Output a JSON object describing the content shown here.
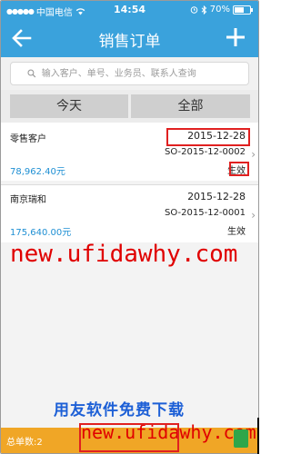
{
  "status_bar": {
    "carrier": "中国电信",
    "time": "14:54",
    "battery_text": "70%",
    "battery_level": 0.7
  },
  "nav": {
    "title": "销售订单",
    "back_icon": "arrow-left-icon",
    "add_icon": "plus-icon"
  },
  "search": {
    "placeholder": "输入客户、单号、业务员、联系人查询",
    "value": ""
  },
  "tabs": [
    {
      "label": "今天"
    },
    {
      "label": "全部"
    }
  ],
  "orders": [
    {
      "customer": "零售客户",
      "date": "2015-12-28",
      "code": "SO-2015-12-0002",
      "amount": "78,962.40元",
      "status": "生效"
    },
    {
      "customer": "南京瑞和",
      "date": "2015-12-28",
      "code": "SO-2015-12-0001",
      "amount": "175,640.00元",
      "status": "生效"
    }
  ],
  "watermarks": {
    "url_large": "new.ufidawhy.com",
    "slogan": "用友软件免费下载",
    "url_small": "new.ufidawhy.com"
  },
  "footer": {
    "text": "总单数:2"
  },
  "colors": {
    "header": "#3aa2dc",
    "amount": "#1e8fd3",
    "footer": "#f0a626",
    "highlight_box": "#e02020"
  }
}
